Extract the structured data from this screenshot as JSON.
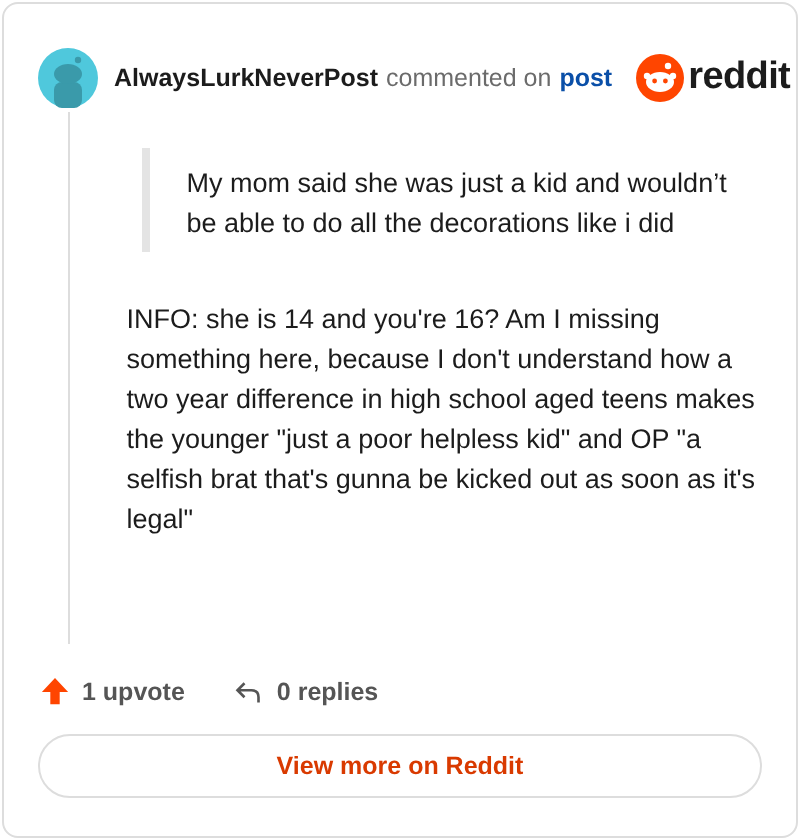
{
  "header": {
    "author": "AlwaysLurkNeverPost",
    "action": "commented on",
    "link": "post",
    "logo": "reddit"
  },
  "quote": "My mom said she was just a kid and wouldn’t be able to do all the decorations like i did",
  "body": "INFO: she is 14 and you're 16? Am I missing something here, because I don't understand how a two year difference in high school aged teens makes the younger \"just a poor helpless kid\" and OP \"a selfish brat that's gunna be kicked out as soon as it's legal\"",
  "upvotes": "1 upvote",
  "replies": "0 replies",
  "button": "View more on Reddit"
}
